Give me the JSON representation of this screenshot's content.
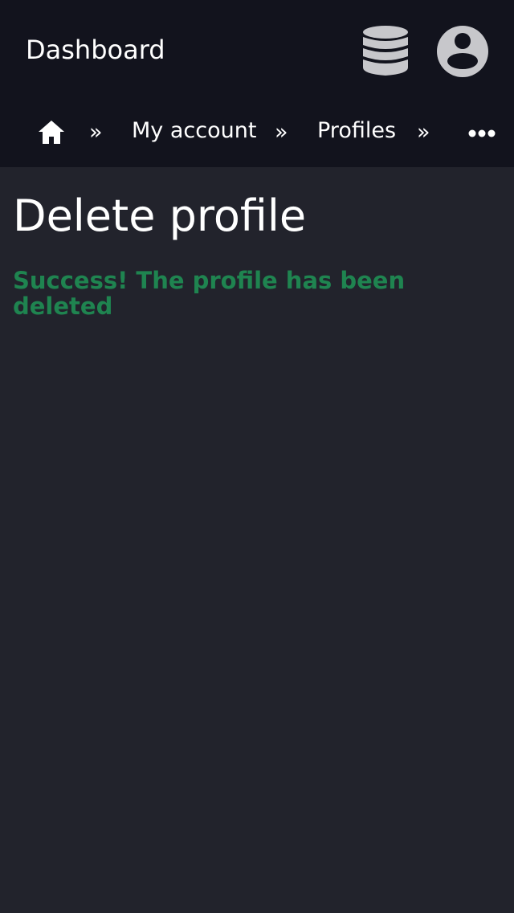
{
  "header": {
    "title": "Dashboard",
    "database_icon": "database-icon",
    "user_icon": "user-circle-icon"
  },
  "breadcrumb": {
    "home_icon": "home-icon",
    "separator": "»",
    "items": [
      {
        "label": "My account"
      },
      {
        "label": "Profiles"
      }
    ],
    "more_icon": "more-horizontal-icon"
  },
  "main": {
    "title": "Delete profile",
    "message": "Success! The profile has been deleted"
  },
  "colors": {
    "header_background": "#12131d",
    "page_background": "#22232c",
    "text": "#ffffff",
    "success": "#1f8450",
    "icon": "#c7c7cb"
  }
}
